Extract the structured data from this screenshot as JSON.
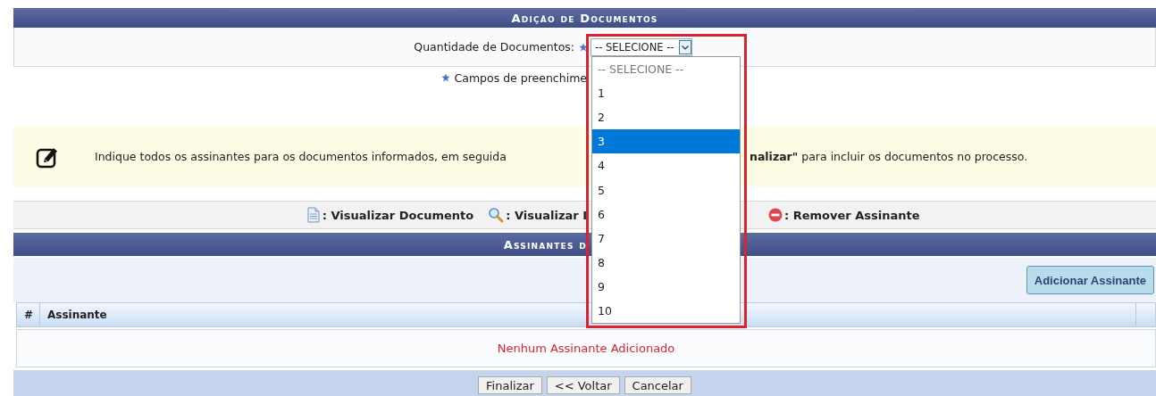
{
  "documents_panel": {
    "title": "Adição de Documentos",
    "field": {
      "label": "Quantidade de Documentos:",
      "value": "-- SELECIONE --"
    },
    "dropdown": {
      "options": [
        {
          "label": "-- SELECIONE --",
          "kind": "placeholder",
          "selected": false
        },
        {
          "label": "1",
          "kind": "number",
          "selected": false
        },
        {
          "label": "2",
          "kind": "number",
          "selected": false
        },
        {
          "label": "3",
          "kind": "number",
          "selected": true
        },
        {
          "label": "4",
          "kind": "number",
          "selected": false
        },
        {
          "label": "5",
          "kind": "number",
          "selected": false
        },
        {
          "label": "6",
          "kind": "number",
          "selected": false
        },
        {
          "label": "7",
          "kind": "number",
          "selected": false
        },
        {
          "label": "8",
          "kind": "number",
          "selected": false
        },
        {
          "label": "9",
          "kind": "number",
          "selected": false
        },
        {
          "label": "10",
          "kind": "number",
          "selected": false
        }
      ]
    },
    "required_note": "Campos de preenchime"
  },
  "info": {
    "text_left": "Indique todos os assinantes para os documentos informados, em seguida",
    "text_right": "**nalizar\"** para incluir os documentos no processo."
  },
  "legend": [
    {
      "kind": "document",
      "label": ": Visualizar Documento"
    },
    {
      "kind": "magnifier",
      "label": ": Visualizar I"
    },
    {
      "kind": "remove",
      "label": ": Remover Assinante"
    }
  ],
  "signers": {
    "title": "Assinantes d",
    "add_button": "Adicionar Assinante",
    "columns": [
      "#",
      "Assinante"
    ],
    "empty_message": "Nenhum Assinante Adicionado"
  },
  "buttons": [
    "Finalizar",
    "<< Voltar",
    "Cancelar"
  ]
}
